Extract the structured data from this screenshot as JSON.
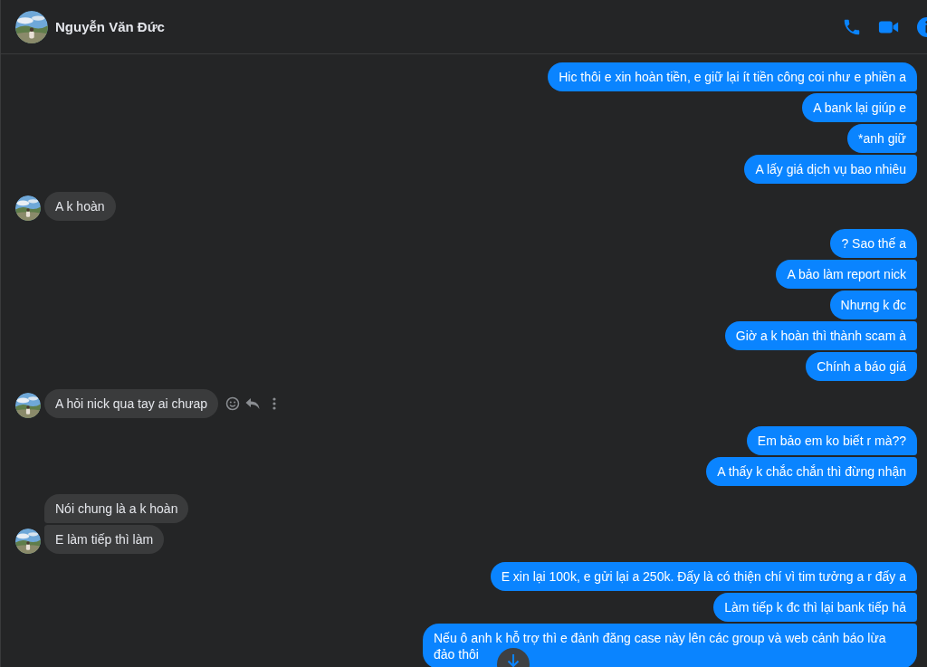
{
  "contact": {
    "name": "Nguyễn Văn Đức"
  },
  "header_actions": [
    {
      "kind": "call"
    },
    {
      "kind": "video"
    },
    {
      "kind": "info"
    }
  ],
  "messages": [
    {
      "kind": "sent",
      "text": "Hic thôi e xin hoàn tiền, e giữ lại ít tiền công coi như e phiền a",
      "hover_actions": false
    },
    {
      "kind": "sent",
      "text": "A bank lại giúp e",
      "hover_actions": false
    },
    {
      "kind": "sent",
      "text": "*anh giữ",
      "hover_actions": false
    },
    {
      "kind": "sent",
      "text": "A lấy giá dịch vụ bao nhiêu",
      "hover_actions": false
    },
    {
      "kind": "received",
      "text": "A k hoàn",
      "hover_actions": false
    },
    {
      "kind": "sent",
      "text": "? Sao thế a",
      "hover_actions": false
    },
    {
      "kind": "sent",
      "text": "A bảo làm report nick",
      "hover_actions": false
    },
    {
      "kind": "sent",
      "text": "Nhưng k đc",
      "hover_actions": false
    },
    {
      "kind": "sent",
      "text": "Giờ a k hoàn thì thành scam à",
      "hover_actions": false
    },
    {
      "kind": "sent",
      "text": "Chính a báo giá",
      "hover_actions": false
    },
    {
      "kind": "received",
      "text": "A hỏi nick qua tay ai chưap",
      "hover_actions": true
    },
    {
      "kind": "sent",
      "text": "Em bảo em ko biết r mà??",
      "hover_actions": false
    },
    {
      "kind": "sent",
      "text": "A thấy k chắc chắn thì đừng nhận",
      "hover_actions": false
    },
    {
      "kind": "received",
      "text": "Nói chung là a k hoàn",
      "hover_actions": false
    },
    {
      "kind": "received",
      "text": "E làm tiếp thì làm",
      "hover_actions": false
    },
    {
      "kind": "sent",
      "text": "E xin lại 100k, e gửi lại a 250k. Đấy là có thiện chí vì tim tưởng a r đấy a",
      "hover_actions": false
    },
    {
      "kind": "sent",
      "text": "Làm tiếp k đc thì lại bank tiếp hả",
      "hover_actions": false
    },
    {
      "kind": "sent",
      "text": "Nếu ô anh k hỗ trợ thì e đành đăng case này lên các group và web cảnh báo lừa đảo thôi",
      "hover_actions": false
    }
  ]
}
